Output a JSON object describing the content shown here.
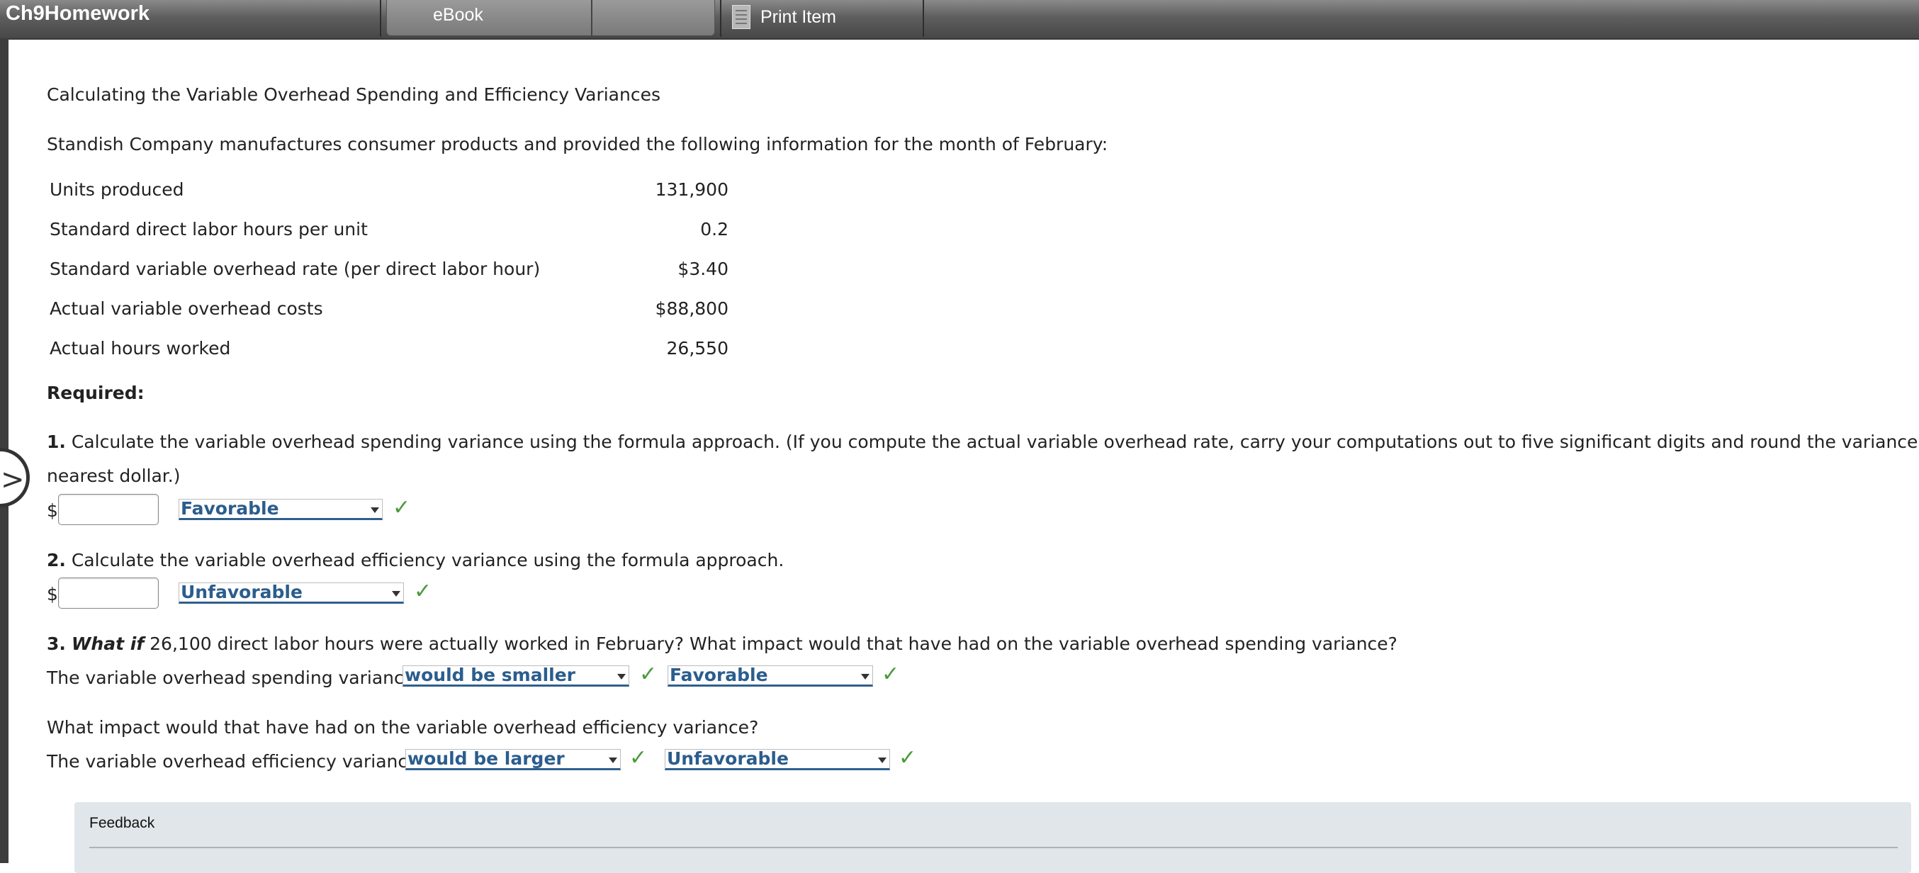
{
  "header": {
    "app_title": "Ch9Homework",
    "tabs": [
      {
        "label": "eBook"
      },
      {
        "label": ""
      }
    ],
    "print_label": "Print Item"
  },
  "problem": {
    "title": "Calculating the Variable Overhead Spending and Efficiency Variances",
    "intro": "Standish Company manufactures consumer products and provided the following information for the month of February:",
    "info_rows": [
      {
        "label": "Units produced",
        "value": "131,900"
      },
      {
        "label": "Standard direct labor hours per unit",
        "value": "0.2"
      },
      {
        "label": "Standard variable overhead rate (per direct labor hour)",
        "value": "$3.40"
      },
      {
        "label": "Actual variable overhead costs",
        "value": "$88,800"
      },
      {
        "label": "Actual hours worked",
        "value": "26,550"
      }
    ],
    "required_label": "Required:"
  },
  "q1": {
    "number": "1.",
    "text_line1": " Calculate the variable overhead spending variance using the formula approach. (If you compute the actual variable overhead rate, carry your computations out to five significant digits and round the variance to the",
    "text_line2": "nearest dollar.)",
    "currency": "$",
    "input_value": "",
    "select_value": "Favorable"
  },
  "q2": {
    "number": "2.",
    "text": " Calculate the variable overhead efficiency variance using the formula approach.",
    "currency": "$",
    "input_value": "",
    "select_value": "Unfavorable"
  },
  "q3": {
    "number": "3.",
    "what_if": "What if",
    "text": " 26,100 direct labor hours were actually worked in February? What impact would that have had on the variable overhead spending variance?",
    "spending_prefix": "The variable overhead spending variance",
    "spending_select1": "would be smaller",
    "spending_select2": "Favorable",
    "efficiency_question": "What impact would that have had on the variable overhead efficiency variance?",
    "efficiency_prefix": "The variable overhead efficiency variance",
    "efficiency_select1": "would be larger",
    "efficiency_select2": "Unfavorable"
  },
  "feedback": {
    "label": "Feedback"
  },
  "icons": {
    "check": "✓",
    "nav": ">"
  },
  "colors": {
    "select_text": "#2b5d8d",
    "check": "#4a9a3a",
    "feedback_bg": "#e0e6ea"
  }
}
